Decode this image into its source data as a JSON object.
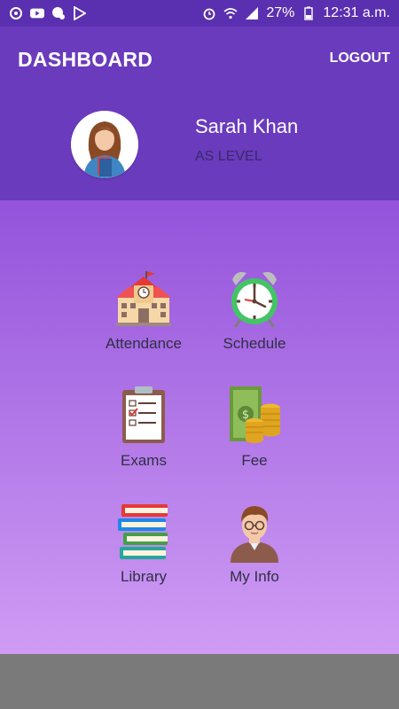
{
  "status_bar": {
    "battery": "27%",
    "time": "12:31 a.m."
  },
  "header": {
    "title": "DASHBOARD",
    "logout_label": "LOGOUT"
  },
  "profile": {
    "name": "Sarah Khan",
    "level": "AS LEVEL"
  },
  "menu": [
    {
      "label": "Attendance",
      "icon": "school-icon"
    },
    {
      "label": "Schedule",
      "icon": "alarm-clock-icon"
    },
    {
      "label": "Exams",
      "icon": "clipboard-icon"
    },
    {
      "label": "Fee",
      "icon": "money-icon"
    },
    {
      "label": "Library",
      "icon": "books-icon"
    },
    {
      "label": "My Info",
      "icon": "person-icon"
    }
  ],
  "colors": {
    "header": "#6a3bbd",
    "status_bar": "#5a2fb0",
    "gradient_top": "#9453db",
    "gradient_bottom": "#cf9cf4",
    "nav_bar": "#7a7a7a"
  }
}
